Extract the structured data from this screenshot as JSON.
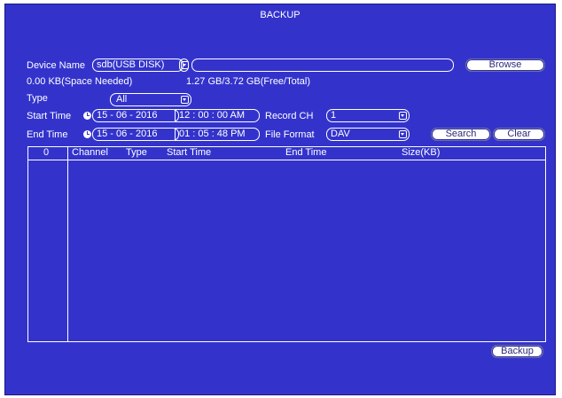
{
  "window": {
    "title": "BACKUP"
  },
  "device": {
    "label": "Device Name",
    "value": "sdb(USB DISK)",
    "path_value": "",
    "browse_label": "Browse"
  },
  "space": {
    "needed": "0.00 KB(Space Needed)",
    "free_total": "1.27 GB/3.72 GB(Free/Total)"
  },
  "type": {
    "label": "Type",
    "value": "All"
  },
  "start_time": {
    "label": "Start Time",
    "date": "15 -  06 -  2016",
    "time": "12 :  00 :  00 AM"
  },
  "end_time": {
    "label": "End Time",
    "date": "15 -  06 -  2016",
    "time": "01 :  05 :  48 PM"
  },
  "record_ch": {
    "label": "Record CH",
    "value": "1"
  },
  "file_format": {
    "label": "File Format",
    "value": "DAV"
  },
  "buttons": {
    "search": "Search",
    "clear": "Clear",
    "backup": "Backup"
  },
  "table": {
    "columns": [
      "0",
      "Channel",
      "Type",
      "Start Time",
      "End Time",
      "Size(KB)"
    ],
    "rows": []
  },
  "colors": {
    "background": "#3333cc",
    "text": "#ffffff",
    "button": "#ffffff"
  }
}
